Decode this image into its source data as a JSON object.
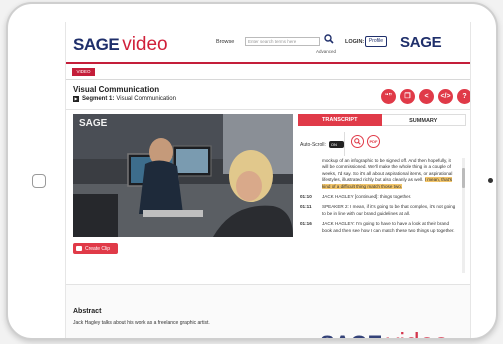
{
  "header": {
    "logo_brand": "SAGE",
    "logo_product": "video",
    "browse_label": "Browse",
    "search_placeholder": "Enter search terms here",
    "advanced_label": "Advanced",
    "login_label": "LOGIN:",
    "profile_label": "Profile",
    "right_logo": "SAGE"
  },
  "nav": {
    "video_tag": "VIDEO"
  },
  "page": {
    "title": "Visual Communication",
    "segment_label": "Segment 1:",
    "segment_name": "Visual Communication"
  },
  "actions": [
    {
      "icon": "quote-icon",
      "glyph": "“”"
    },
    {
      "icon": "copy-icon",
      "glyph": "❒"
    },
    {
      "icon": "share-icon",
      "glyph": "<"
    },
    {
      "icon": "embed-icon",
      "glyph": "</>"
    },
    {
      "icon": "help-icon",
      "glyph": "?"
    }
  ],
  "video": {
    "watermark": "SAGE"
  },
  "clip": {
    "label": "Create Clip"
  },
  "panel": {
    "tab_transcript": "TRANSCRIPT",
    "tab_summary": "SUMMARY",
    "autoscroll_label": "Auto-Scroll:",
    "autoscroll_state": "ON",
    "pdf_label": "PDF"
  },
  "transcript": [
    {
      "time": "",
      "text": "mockup of an infographic to be signed off. And then hopefully, it will be commissioned. We'll make the whole thing in a couple of weeks, I'd say. So it's all about aspirational items, or aspirational lifestyles, illustrated richly but also cleanly as well.",
      "highlight": "I mean, that's kind of a difficult thing match those two."
    },
    {
      "time": "01:10",
      "text": "JACK HAGLEY [continued]: things together.",
      "highlight": ""
    },
    {
      "time": "01:11",
      "text": "SPEAKER 2: I mean, if it's going to be that complex, it's not going to be in line with our brand guidelines at all.",
      "highlight": ""
    },
    {
      "time": "01:16",
      "text": "JACK HAGLEY: I'm going to have to have a look at their brand book and then see how I can match these two things up together.",
      "highlight": ""
    }
  ],
  "abstract": {
    "title": "Abstract",
    "text": "Jack Hagley talks about his work as a freelance graphic artist."
  },
  "footer": {
    "logo_brand": "SAGE",
    "logo_product": "video"
  },
  "colors": {
    "brand_red": "#e03a48",
    "brand_navy": "#1f2f6b",
    "highlight": "#f3c66b"
  }
}
